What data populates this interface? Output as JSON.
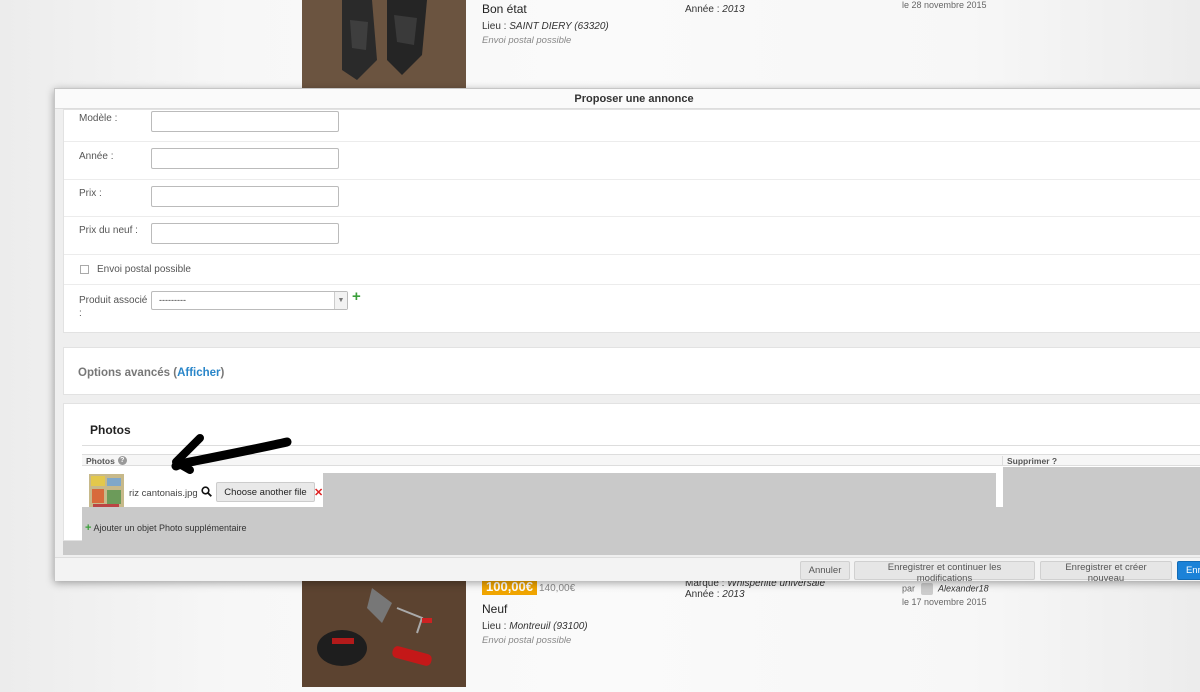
{
  "background_listings": [
    {
      "state": "Bon état",
      "lieu_label": "Lieu : ",
      "lieu_value": "SAINT DIERY (63320)",
      "envoi": "Envoi postal possible",
      "annee_label": "Année : ",
      "annee_value": "2013",
      "date": "le 28 novembre 2015"
    },
    {
      "price": "100,00€",
      "old_price": "140,00€",
      "state": "Neuf",
      "lieu_label": "Lieu : ",
      "lieu_value": "Montreuil (93100)",
      "envoi": "Envoi postal possible",
      "marque_label": "Marque : ",
      "marque_value": "Whisperlite universale",
      "annee_label": "Année : ",
      "annee_value": "2013",
      "par_label": "par",
      "author": "Alexander18",
      "date": "le 17 novembre 2015"
    }
  ],
  "modal": {
    "title": "Proposer une annonce",
    "fields": {
      "modele_label": "Modèle :",
      "annee_label": "Année :",
      "prix_label": "Prix :",
      "prix_neuf_label": "Prix du neuf :",
      "envoi_label": "Envoi postal possible",
      "produit_label_1": "Produit associé",
      "produit_label_2": ":",
      "produit_value": "---------"
    },
    "advanced": {
      "prefix": "Options avancés (",
      "link": "Afficher",
      "suffix": ")"
    },
    "photos": {
      "title": "Photos",
      "column_photos": "Photos",
      "help": "?",
      "column_delete": "Supprimer ?",
      "filename": "riz cantonais.jpg",
      "choose_button": "Choose another file",
      "add_link": "Ajouter un objet Photo supplémentaire"
    },
    "footer": {
      "cancel": "Annuler",
      "save_continue": "Enregistrer et continuer les modifications",
      "save_new": "Enregistrer et créer nouveau",
      "save": "Enre"
    }
  }
}
